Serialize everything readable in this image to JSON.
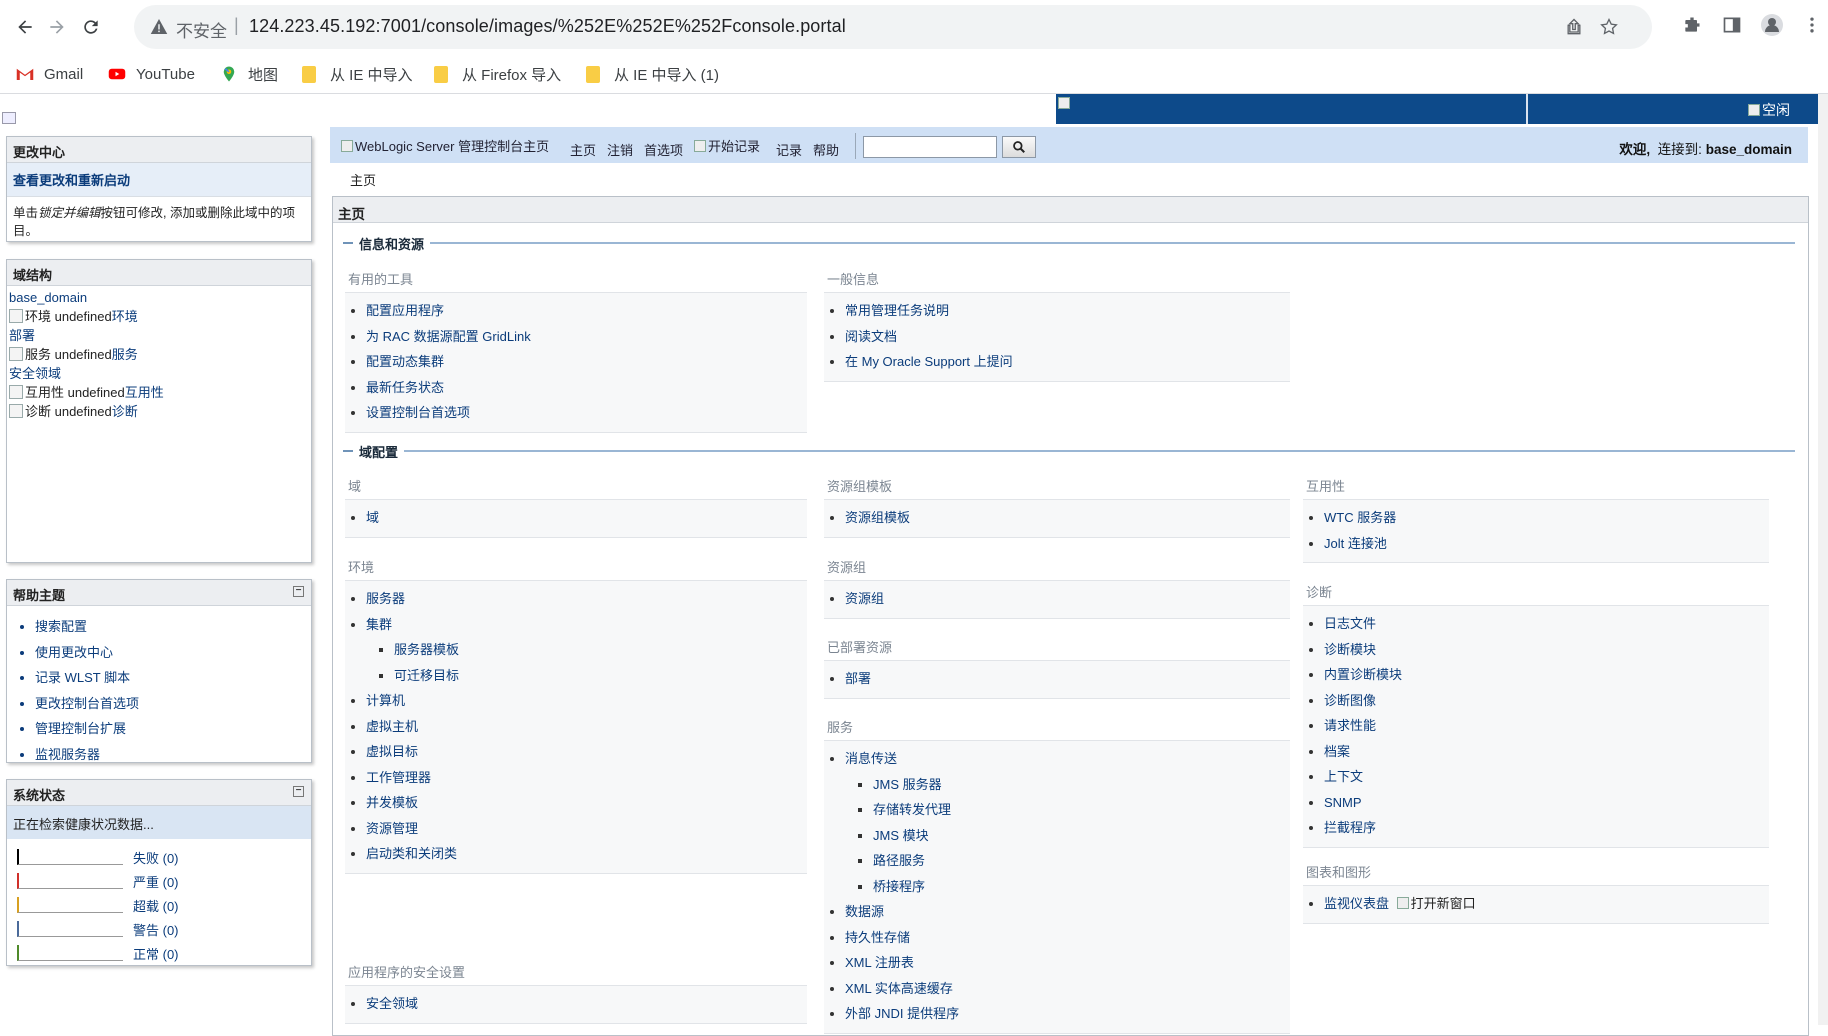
{
  "browser": {
    "insecure_label": "不安全",
    "url": "124.223.45.192:7001/console/images/%252E%252E%252Fconsole.portal",
    "bookmarks": [
      {
        "label": "Gmail"
      },
      {
        "label": "YouTube"
      },
      {
        "label": "地图"
      },
      {
        "label": "从 IE 中导入"
      },
      {
        "label": "从 Firefox 导入"
      },
      {
        "label": "从 IE 中导入 (1)"
      }
    ]
  },
  "banner": {
    "idle_alt": "空闲"
  },
  "console_bar": {
    "home_img_alt": "WebLogic Server 管理控制台主页",
    "home": "主页",
    "logout": "注销",
    "preferences": "首选项",
    "record_img_alt": "开始记录",
    "record": "记录",
    "help": "帮助",
    "welcome": "欢迎,",
    "connected_label": "连接到:",
    "domain": "base_domain"
  },
  "breadcrumb": "主页",
  "change_center": {
    "title": "更改中心",
    "link": "查看更改和重新启动",
    "description_prefix": "单击",
    "description_italic": "锁定并编辑",
    "description_suffix": "按钮可修改, 添加或删除此域中的项目。"
  },
  "domain_structure": {
    "title": "域结构",
    "root": "base_domain",
    "nodes": [
      {
        "alt": "环境 undefined",
        "label": "环境"
      },
      {
        "label": "部署"
      },
      {
        "alt": "服务 undefined",
        "label": "服务"
      },
      {
        "label": "安全领域"
      },
      {
        "alt": "互用性 undefined",
        "label": "互用性"
      },
      {
        "alt": "诊断 undefined",
        "label": "诊断"
      }
    ]
  },
  "help_topics": {
    "title": "帮助主题",
    "items": [
      "搜索配置",
      "使用更改中心",
      "记录 WLST 脚本",
      "更改控制台首选项",
      "管理控制台扩展",
      "监视服务器"
    ]
  },
  "system_status": {
    "title": "系统状态",
    "message": "正在检索健康状况数据...",
    "rows": [
      {
        "label": "失败 (0)",
        "color": "#000000"
      },
      {
        "label": "严重 (0)",
        "color": "#d0302a"
      },
      {
        "label": "超载 (0)",
        "color": "#d8a020"
      },
      {
        "label": "警告 (0)",
        "color": "#4a6a9a"
      },
      {
        "label": "正常 (0)",
        "color": "#4f8a2a"
      }
    ]
  },
  "main": {
    "title": "主页",
    "section1": "信息和资源",
    "useful_tools": {
      "title": "有用的工具",
      "items": [
        "配置应用程序",
        "为 RAC 数据源配置 GridLink",
        "配置动态集群",
        "最新任务状态",
        "设置控制台首选项"
      ]
    },
    "general_info": {
      "title": "一般信息",
      "items": [
        "常用管理任务说明",
        "阅读文档",
        "在 My Oracle Support 上提问"
      ]
    },
    "section2": "域配置",
    "domain": {
      "title": "域",
      "items": [
        "域"
      ]
    },
    "environment": {
      "title": "环境",
      "items": [
        "服务器",
        "集群",
        "服务器模板",
        "可迁移目标",
        "计算机",
        "虚拟主机",
        "虚拟目标",
        "工作管理器",
        "并发模板",
        "资源管理",
        "启动类和关闭类"
      ]
    },
    "app_security": {
      "title": "应用程序的安全设置",
      "items": [
        "安全领域"
      ]
    },
    "resource_group_templates": {
      "title": "资源组模板",
      "items": [
        "资源组模板"
      ]
    },
    "resource_groups": {
      "title": "资源组",
      "items": [
        "资源组"
      ]
    },
    "deployed_resources": {
      "title": "已部署资源",
      "items": [
        "部署"
      ]
    },
    "services": {
      "title": "服务",
      "items": [
        "消息传送",
        "JMS 服务器",
        "存储转发代理",
        "JMS 模块",
        "路径服务",
        "桥接程序",
        "数据源",
        "持久性存储",
        "XML 注册表",
        "XML 实体高速缓存",
        "外部 JNDI 提供程序"
      ]
    },
    "interoperability": {
      "title": "互用性",
      "items": [
        "WTC 服务器",
        "Jolt 连接池"
      ]
    },
    "diagnostics": {
      "title": "诊断",
      "items": [
        "日志文件",
        "诊断模块",
        "内置诊断模块",
        "诊断图像",
        "请求性能",
        "档案",
        "上下文",
        "SNMP",
        "拦截程序"
      ]
    },
    "charts": {
      "title": "图表和图形",
      "items": [
        "监视仪表盘"
      ],
      "new_window_alt": "打开新窗口"
    }
  }
}
